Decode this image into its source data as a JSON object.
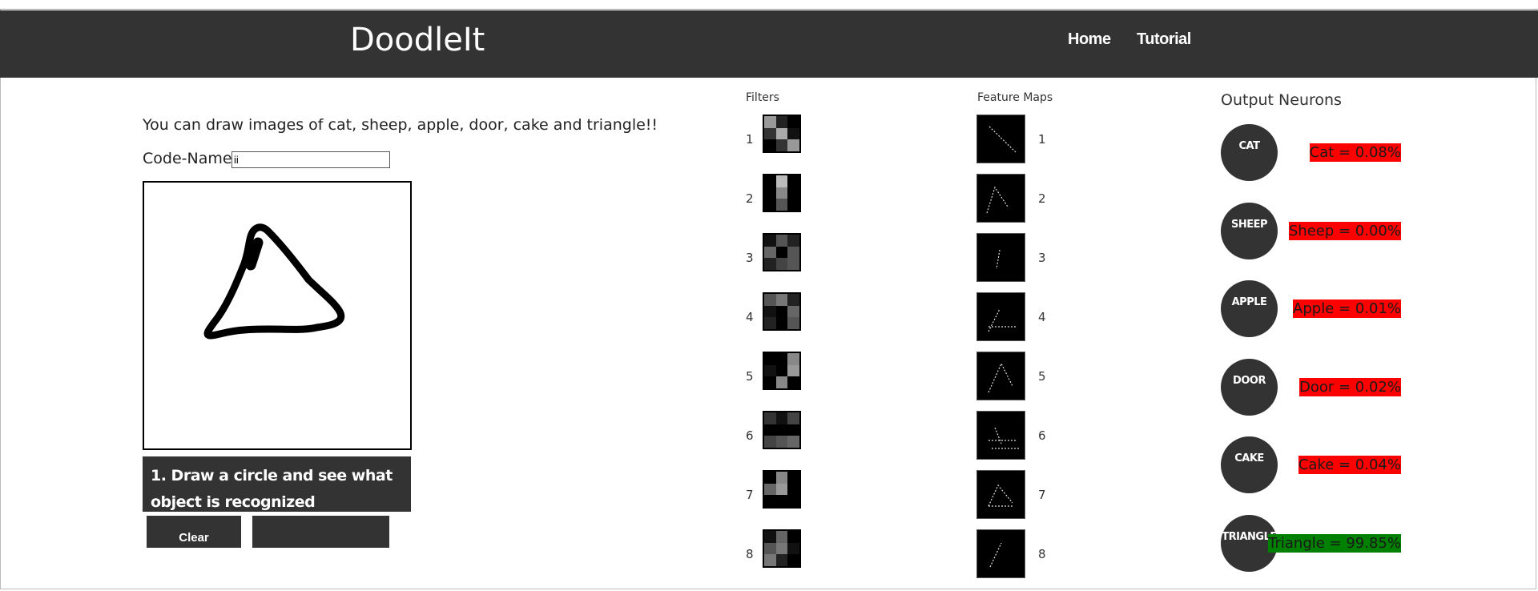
{
  "app": {
    "brand": "DoodleIt"
  },
  "nav": {
    "home": "Home",
    "tutorial": "Tutorial"
  },
  "left": {
    "intro": "You can draw images of cat, sheep, apple, door, cake and triangle!!",
    "code_name_label": "Code-Name :",
    "code_name_value": "ii",
    "instruction": "1. Draw a circle and see what object is recognized",
    "clear_label": "Clear",
    "second_button_label": ""
  },
  "filters": {
    "heading": "Filters",
    "labels": [
      "1",
      "2",
      "3",
      "4",
      "5",
      "6",
      "7",
      "8"
    ]
  },
  "feature_maps": {
    "heading": "Feature Maps",
    "labels": [
      "1",
      "2",
      "3",
      "4",
      "5",
      "6",
      "7",
      "8"
    ]
  },
  "output": {
    "heading": "Output Neurons",
    "neurons": [
      {
        "name": "CAT",
        "text": "Cat = 0.08%",
        "color": "#ff0000"
      },
      {
        "name": "SHEEP",
        "text": "Sheep = 0.00%",
        "color": "#ff0000"
      },
      {
        "name": "APPLE",
        "text": "Apple = 0.01%",
        "color": "#ff0000"
      },
      {
        "name": "DOOR",
        "text": "Door = 0.02%",
        "color": "#ff0000"
      },
      {
        "name": "CAKE",
        "text": "Cake = 0.04%",
        "color": "#ff0000"
      },
      {
        "name": "TRIANGLE",
        "text": "Triangle = 99.85%",
        "color": "#008000"
      }
    ]
  },
  "colors": {
    "navbar": "#333333",
    "negative": "#ff0000",
    "positive": "#008000"
  }
}
